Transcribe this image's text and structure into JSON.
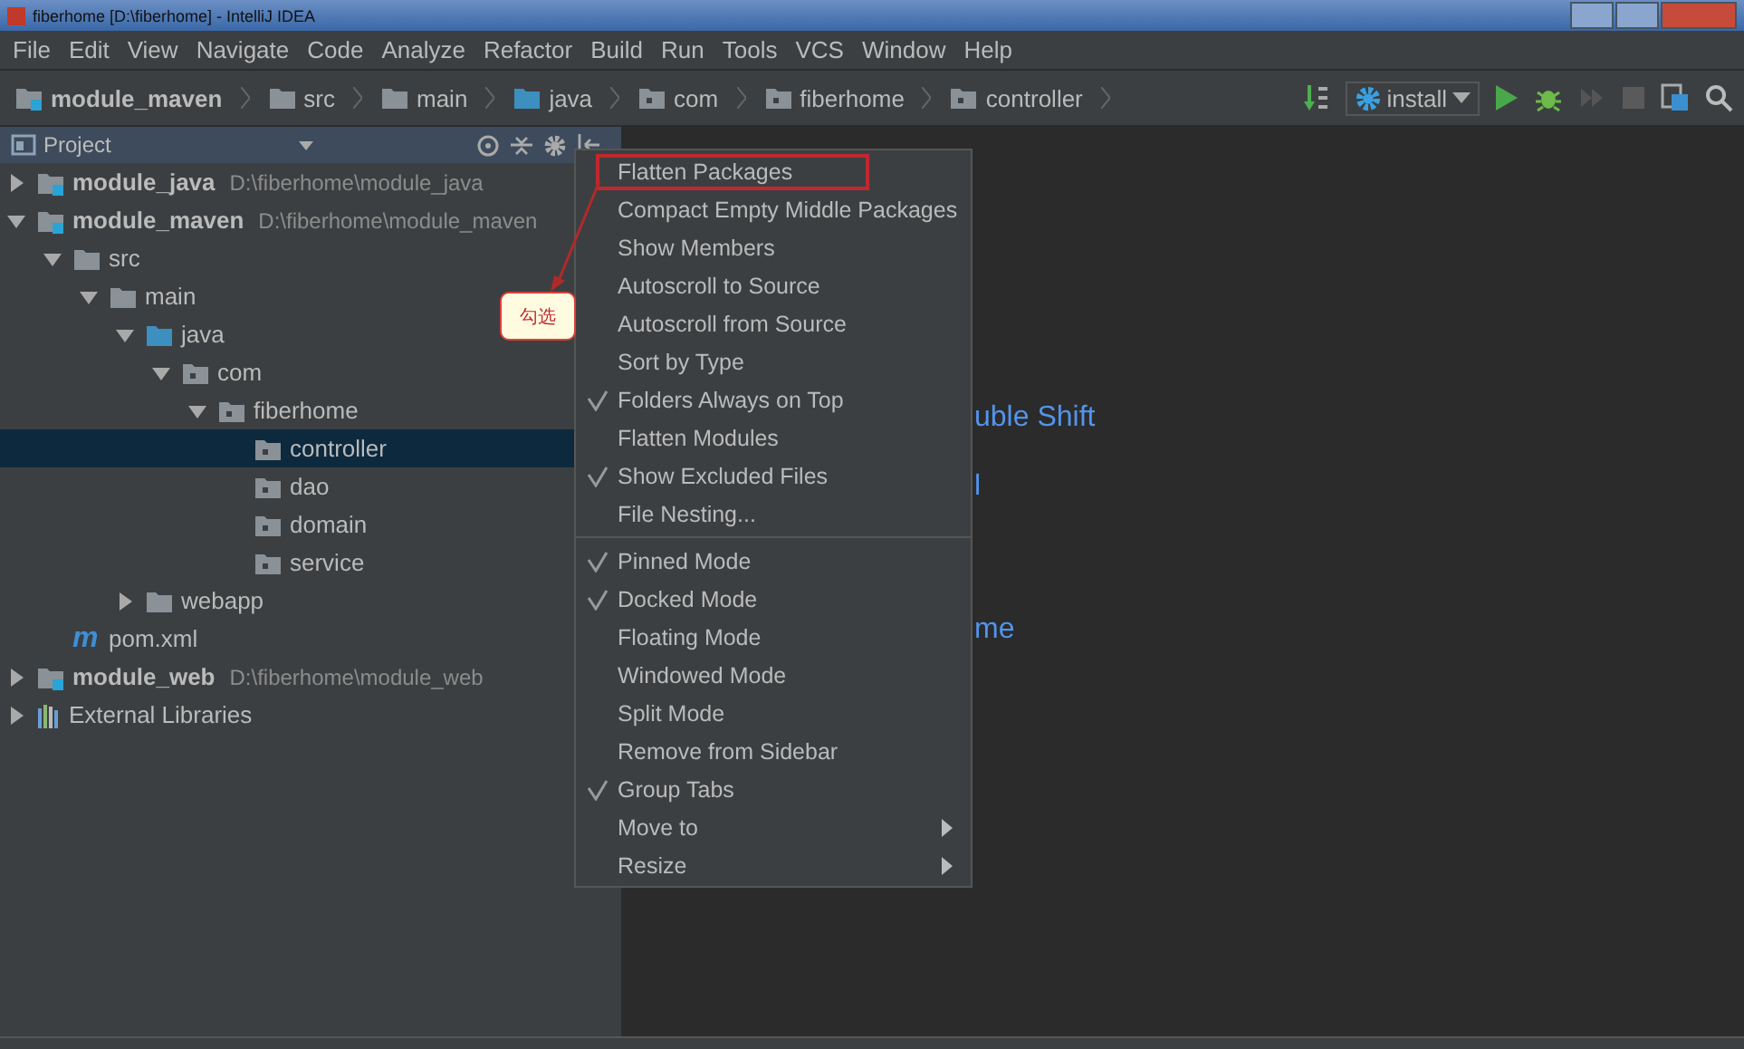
{
  "window": {
    "title": "fiberhome [D:\\fiberhome] - IntelliJ IDEA"
  },
  "menu_bar": [
    "File",
    "Edit",
    "View",
    "Navigate",
    "Code",
    "Analyze",
    "Refactor",
    "Build",
    "Run",
    "Tools",
    "VCS",
    "Window",
    "Help"
  ],
  "breadcrumbs": [
    {
      "label": "module_maven",
      "kind": "module"
    },
    {
      "label": "src",
      "kind": "folder"
    },
    {
      "label": "main",
      "kind": "folder"
    },
    {
      "label": "java",
      "kind": "source"
    },
    {
      "label": "com",
      "kind": "package"
    },
    {
      "label": "fiberhome",
      "kind": "package"
    },
    {
      "label": "controller",
      "kind": "package"
    }
  ],
  "run_config": {
    "label": "install"
  },
  "project_panel": {
    "title": "Project",
    "tree": [
      {
        "name": "module_java",
        "path": "D:\\fiberhome\\module_java",
        "kind": "module",
        "expanded": false,
        "selected": false
      },
      {
        "name": "module_maven",
        "path": "D:\\fiberhome\\module_maven",
        "kind": "module",
        "expanded": true,
        "selected": false,
        "children": [
          {
            "name": "src",
            "kind": "folder",
            "expanded": true,
            "selected": false,
            "children": [
              {
                "name": "main",
                "kind": "folder",
                "expanded": true,
                "selected": false,
                "children": [
                  {
                    "name": "java",
                    "kind": "source",
                    "expanded": true,
                    "selected": false,
                    "children": [
                      {
                        "name": "com",
                        "kind": "package",
                        "expanded": true,
                        "selected": false,
                        "children": [
                          {
                            "name": "fiberhome",
                            "kind": "package",
                            "expanded": true,
                            "selected": false,
                            "children": [
                              {
                                "name": "controller",
                                "kind": "package",
                                "selected": true
                              },
                              {
                                "name": "dao",
                                "kind": "package",
                                "selected": false
                              },
                              {
                                "name": "domain",
                                "kind": "package",
                                "selected": false
                              },
                              {
                                "name": "service",
                                "kind": "package",
                                "selected": false
                              }
                            ]
                          }
                        ]
                      }
                    ]
                  },
                  {
                    "name": "webapp",
                    "kind": "folder",
                    "expanded": false,
                    "selected": false
                  }
                ]
              }
            ]
          },
          {
            "name": "pom.xml",
            "kind": "maven",
            "glyph": "m",
            "selected": false
          }
        ]
      },
      {
        "name": "module_web",
        "path": "D:\\fiberhome\\module_web",
        "kind": "module",
        "expanded": false,
        "selected": false
      },
      {
        "name": "External Libraries",
        "kind": "libraries",
        "expanded": false,
        "selected": false
      }
    ]
  },
  "editor_hints": [
    "uble Shift",
    "l",
    "me"
  ],
  "context_menu": {
    "groups": [
      [
        {
          "label": "Flatten Packages",
          "checked": false,
          "submenu": false,
          "marked": true
        },
        {
          "label": "Compact Empty Middle Packages",
          "checked": false,
          "submenu": false,
          "marked": false
        },
        {
          "label": "Show Members",
          "checked": false,
          "submenu": false,
          "marked": false
        },
        {
          "label": "Autoscroll to Source",
          "checked": false,
          "submenu": false,
          "marked": false
        },
        {
          "label": "Autoscroll from Source",
          "checked": false,
          "submenu": false,
          "marked": false
        },
        {
          "label": "Sort by Type",
          "checked": false,
          "submenu": false,
          "marked": false
        },
        {
          "label": "Folders Always on Top",
          "checked": true,
          "submenu": false,
          "marked": false
        },
        {
          "label": "Flatten Modules",
          "checked": false,
          "submenu": false,
          "marked": false
        },
        {
          "label": "Show Excluded Files",
          "checked": true,
          "submenu": false,
          "marked": false
        },
        {
          "label": "File Nesting...",
          "checked": false,
          "submenu": false,
          "marked": false
        }
      ],
      [
        {
          "label": "Pinned Mode",
          "checked": true,
          "submenu": false,
          "marked": false
        },
        {
          "label": "Docked Mode",
          "checked": true,
          "submenu": false,
          "marked": false
        },
        {
          "label": "Floating Mode",
          "checked": false,
          "submenu": false,
          "marked": false
        },
        {
          "label": "Windowed Mode",
          "checked": false,
          "submenu": false,
          "marked": false
        },
        {
          "label": "Split Mode",
          "checked": false,
          "submenu": false,
          "marked": false
        },
        {
          "label": "Remove from Sidebar",
          "checked": false,
          "submenu": false,
          "marked": false
        },
        {
          "label": "Group Tabs",
          "checked": true,
          "submenu": false,
          "marked": false
        },
        {
          "label": "Move to",
          "checked": false,
          "submenu": true,
          "marked": false
        },
        {
          "label": "Resize",
          "checked": false,
          "submenu": true,
          "marked": false
        }
      ]
    ]
  },
  "annotation": {
    "text": "勾选"
  }
}
